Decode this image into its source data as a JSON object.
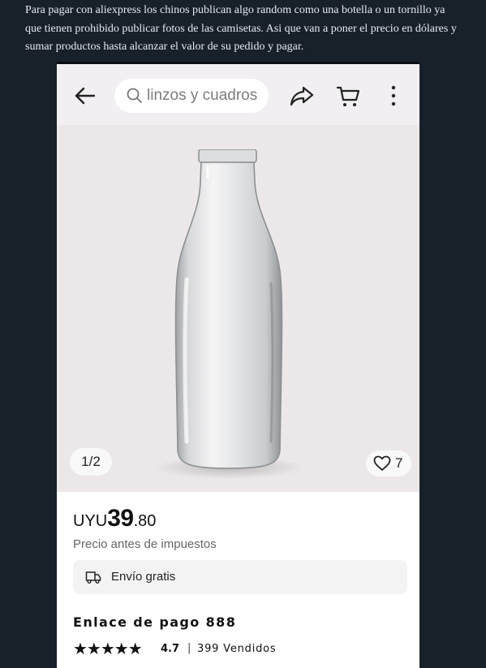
{
  "post": {
    "text": "Para pagar con aliexpress los chinos publican algo random como una botella o un tornillo ya que tienen prohibido publicar fotos de las camisetas. Asi que van a poner el precio en dólares y sumar productos hasta alcanzar el valor de su pedido y pagar."
  },
  "topbar": {
    "back_icon": "arrow-left-icon",
    "search": {
      "placeholder": "linzos y cuadros",
      "icon": "search-icon"
    },
    "share_icon": "share-icon",
    "cart_icon": "cart-icon",
    "more_icon": "more-vertical-icon"
  },
  "gallery": {
    "image": "glass-bottle",
    "pager": "1/2",
    "likes": "7"
  },
  "product": {
    "currency": "UYU",
    "price_integer": "39",
    "price_decimal": ".80",
    "price_note": "Precio antes de impuestos",
    "shipping": "Envío gratis",
    "title": "Enlace de pago 888",
    "rating": "4.7",
    "rating_separator": "|",
    "sold": "399 Vendidos",
    "stars": "★★★★★"
  },
  "colors": {
    "page_background": "#18212a",
    "topbar_background": "#f1eff1",
    "gallery_background": "#ece8ea"
  }
}
